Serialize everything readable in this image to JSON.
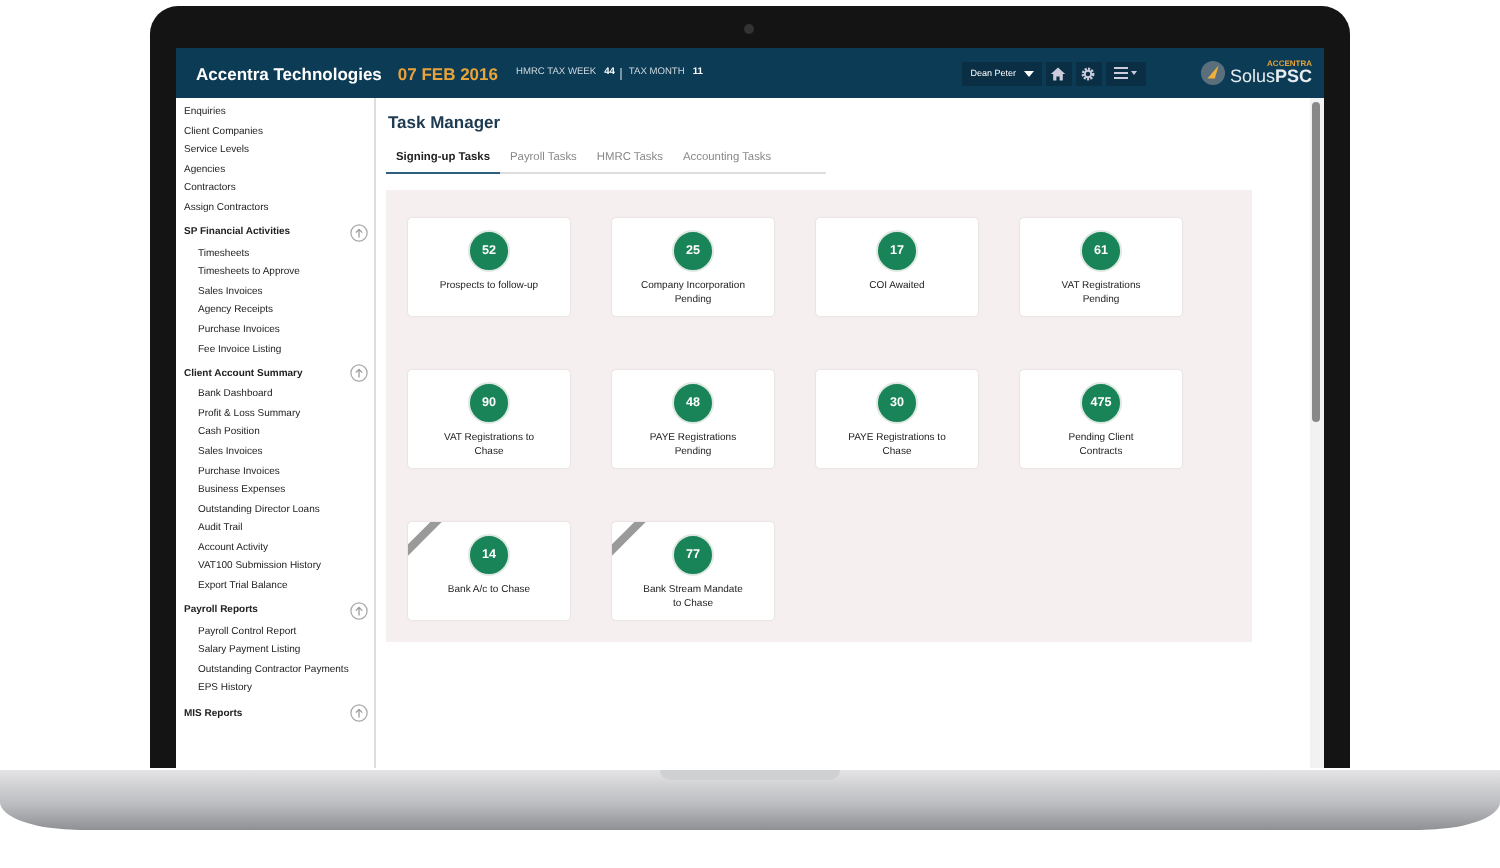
{
  "header": {
    "company": "Accentra Technologies",
    "date": "07 FEB 2016",
    "tax_week_label": "HMRC TAX WEEK",
    "tax_week": "44",
    "tax_month_label": "TAX MONTH",
    "tax_month": "11",
    "user": "Dean Peter",
    "logo_small": "ACCENTRA",
    "logo": "Solus**PSC**"
  },
  "sidebar": {
    "items": [
      {
        "label": "Enquiries",
        "kind": "link"
      },
      {
        "label": "Client Companies",
        "kind": "link"
      },
      {
        "label": "Service Levels",
        "kind": "link"
      },
      {
        "label": "Agencies",
        "kind": "link"
      },
      {
        "label": "Contractors",
        "kind": "link"
      },
      {
        "label": "Assign Contractors",
        "kind": "link"
      },
      {
        "label": "SP Financial Activities",
        "kind": "section",
        "expanded": true,
        "children": [
          {
            "label": "Timesheets"
          },
          {
            "label": "Timesheets to Approve"
          },
          {
            "label": "Sales Invoices"
          },
          {
            "label": "Agency Receipts"
          },
          {
            "label": "Purchase Invoices"
          },
          {
            "label": "Fee Invoice Listing"
          }
        ]
      },
      {
        "label": "Client Account Summary",
        "kind": "section",
        "expanded": true,
        "children": [
          {
            "label": "Bank Dashboard"
          },
          {
            "label": "Profit & Loss Summary"
          },
          {
            "label": "Cash Position"
          },
          {
            "label": "Sales Invoices"
          },
          {
            "label": "Purchase Invoices"
          },
          {
            "label": "Business Expenses"
          },
          {
            "label": "Outstanding Director Loans"
          },
          {
            "label": "Audit Trail"
          },
          {
            "label": "Account Activity"
          },
          {
            "label": "VAT100 Submission History"
          },
          {
            "label": "Export Trial Balance"
          }
        ]
      },
      {
        "label": "Payroll Reports",
        "kind": "section",
        "expanded": true,
        "children": [
          {
            "label": "Payroll Control Report"
          },
          {
            "label": "Salary Payment Listing"
          },
          {
            "label": "Outstanding Contractor Payments"
          },
          {
            "label": "EPS History"
          }
        ]
      },
      {
        "label": "MIS Reports",
        "kind": "section",
        "expanded": true
      }
    ]
  },
  "title": "Task Manager",
  "tabs": [
    {
      "label": "Signing-up Tasks",
      "selected": true
    },
    {
      "label": "Payroll Tasks",
      "selected": false
    },
    {
      "label": "HMRC Tasks",
      "selected": false
    },
    {
      "label": "Accounting Tasks",
      "selected": false
    }
  ],
  "cards": [
    {
      "count": "52",
      "label": "Prospects to follow-up",
      "ribbon": false
    },
    {
      "count": "25",
      "label": "Company Incorporation Pending",
      "ribbon": false
    },
    {
      "count": "17",
      "label": "COI Awaited",
      "ribbon": false
    },
    {
      "count": "61",
      "label": "VAT Registrations Pending",
      "ribbon": false
    },
    {
      "count": "90",
      "label": "VAT Registrations to Chase",
      "ribbon": false
    },
    {
      "count": "48",
      "label": "PAYE Registrations Pending",
      "ribbon": false
    },
    {
      "count": "30",
      "label": "PAYE Registrations to Chase",
      "ribbon": false
    },
    {
      "count": "475",
      "label": "Pending Client Contracts",
      "ribbon": false
    },
    {
      "count": "14",
      "label": "Bank A/c to Chase",
      "ribbon": true
    },
    {
      "count": "77",
      "label": "Bank Stream Mandate to Chase",
      "ribbon": true
    }
  ]
}
